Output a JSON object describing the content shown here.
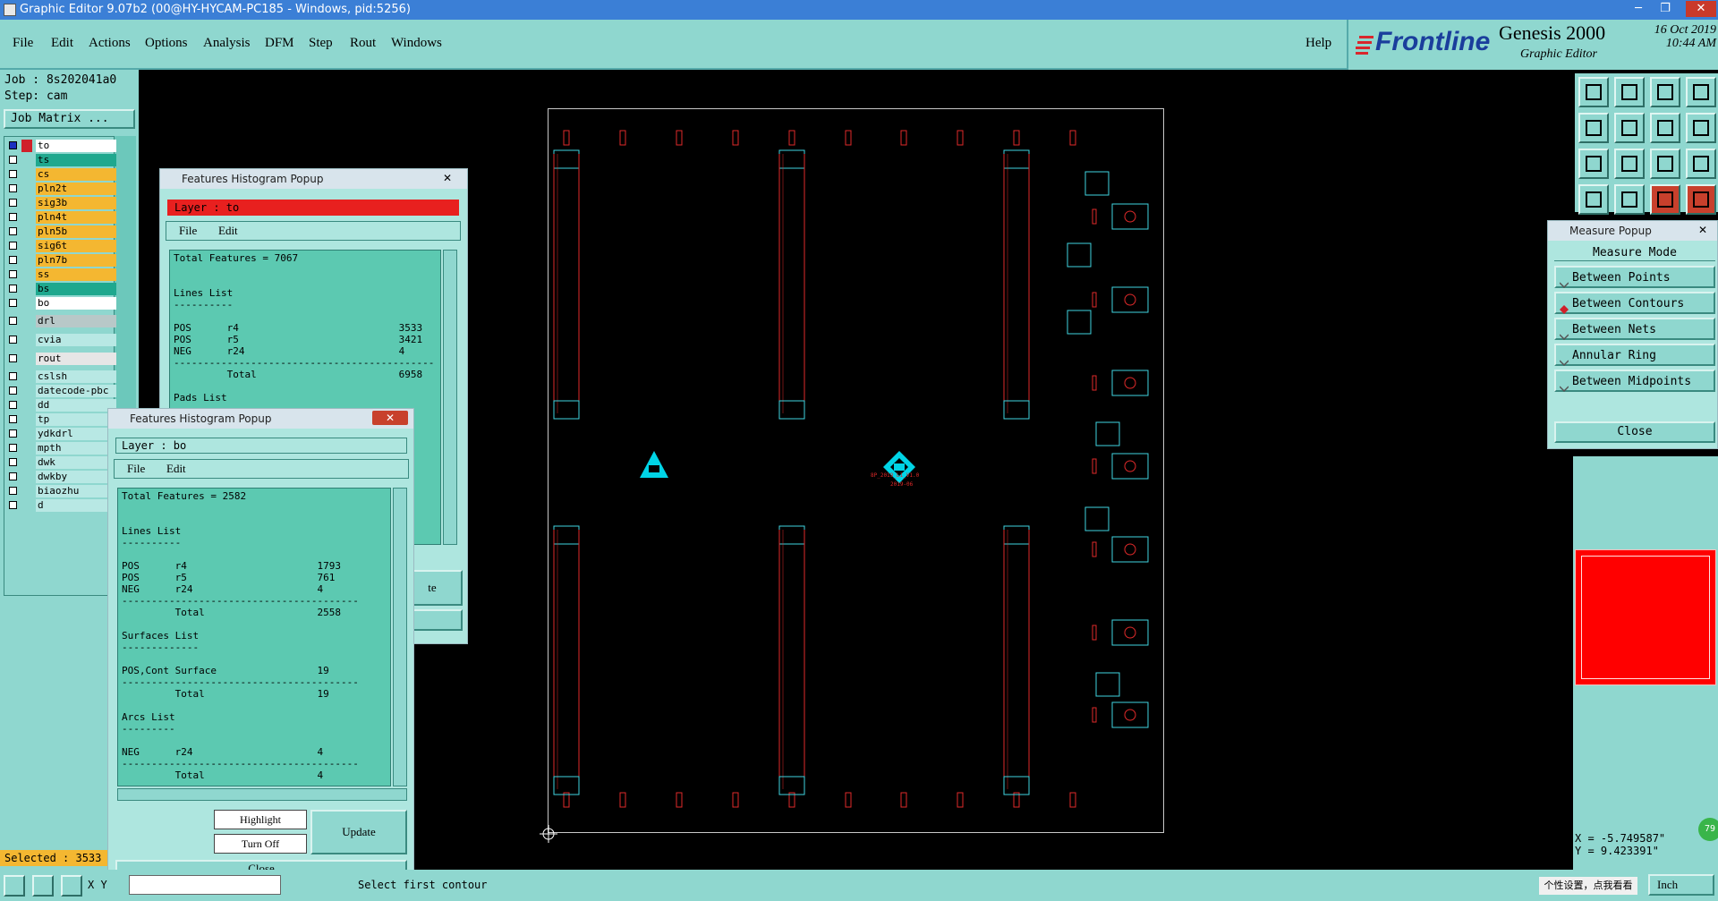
{
  "window": {
    "title": "Graphic Editor 9.07b2 (00@HY-HYCAM-PC185 - Windows, pid:5256)",
    "min": "─",
    "max": "❐",
    "close": "✕"
  },
  "menu": {
    "items": [
      "File",
      "Edit",
      "Actions",
      "Options",
      "Analysis",
      "DFM",
      "Step",
      "Rout",
      "Windows"
    ],
    "help": "Help"
  },
  "brand": {
    "logo": "Frontline",
    "product": "Genesis 2000",
    "subtitle": "Graphic Editor",
    "date": "16 Oct 2019",
    "time": "10:44 AM"
  },
  "job": {
    "job_label": "Job : 8s202041a0",
    "step_label": "Step: cam",
    "matrix_button": "Job Matrix ..."
  },
  "layers": [
    {
      "name": "to",
      "color": "#ffffff",
      "active": true
    },
    {
      "name": "ts",
      "color": "#1fa88e"
    },
    {
      "name": "cs",
      "color": "#f4b731"
    },
    {
      "name": "pln2t",
      "color": "#f4b731"
    },
    {
      "name": "sig3b",
      "color": "#f4b731"
    },
    {
      "name": "pln4t",
      "color": "#f4b731"
    },
    {
      "name": "pln5b",
      "color": "#f4b731"
    },
    {
      "name": "sig6t",
      "color": "#f4b731"
    },
    {
      "name": "pln7b",
      "color": "#f4b731"
    },
    {
      "name": "ss",
      "color": "#f4b731"
    },
    {
      "name": "bs",
      "color": "#1fa88e"
    },
    {
      "name": "bo",
      "color": "#ffffff"
    },
    {
      "name": "drl",
      "color": "#b8c8c8"
    },
    {
      "name": "cvia",
      "color": "#b8e8e4"
    },
    {
      "name": "rout",
      "color": "#e6e6e6"
    },
    {
      "name": "cslsh",
      "color": "#b8e8e4"
    },
    {
      "name": "datecode-pbc",
      "color": "#b8e8e4"
    },
    {
      "name": "dd",
      "color": "#b8e8e4"
    },
    {
      "name": "tp",
      "color": "#b8e8e4"
    },
    {
      "name": "ydkdrl",
      "color": "#b8e8e4"
    },
    {
      "name": "mpth",
      "color": "#b8e8e4"
    },
    {
      "name": "dwk",
      "color": "#b8e8e4"
    },
    {
      "name": "dwkby",
      "color": "#b8e8e4"
    },
    {
      "name": "biaozhu",
      "color": "#b8e8e4"
    },
    {
      "name": "d",
      "color": "#b8e8e4"
    }
  ],
  "selected": "Selected : 3533",
  "popup1": {
    "title": "Features Histogram Popup",
    "layer": "Layer :  to",
    "menu": [
      "File",
      "Edit"
    ],
    "text": "Total Features = 7067\n\n\nLines List\n----------\n\nPOS      r4                           3533\nPOS      r5                           3421\nNEG      r24                          4\n--------------------------------------------\n         Total                        6958\n\nPads List",
    "partial_button": "te"
  },
  "popup2": {
    "title": "Features Histogram Popup",
    "layer": "Layer :  bo",
    "menu": [
      "File",
      "Edit"
    ],
    "text": "Total Features = 2582\n\n\nLines List\n----------\n\nPOS      r4                      1793\nPOS      r5                      761\nNEG      r24                     4\n----------------------------------------\n         Total                   2558\n\nSurfaces List\n-------------\n\nPOS,Cont Surface                 19\n----------------------------------------\n         Total                   19\n\nArcs List\n---------\n\nNEG      r24                     4\n----------------------------------------\n         Total                   4",
    "highlight": "Highlight",
    "turn_off": "Turn Off",
    "update": "Update",
    "close": "Close"
  },
  "measure": {
    "title": "Measure Popup",
    "mode_label": "Measure Mode",
    "options": [
      "Between Points",
      "Between Contours",
      "Between Nets",
      "Annular Ring",
      "Between Midpoints"
    ],
    "selected_index": 1,
    "close": "Close"
  },
  "coords": {
    "x": "X = -5.749587\"",
    "y": "Y =  9.423391\""
  },
  "status": {
    "xy": "X Y",
    "prompt": "Select first contour",
    "ime": "个性设置，点我看看",
    "units": "Inch"
  },
  "board": {
    "center_text": "8P_2019_L1_V1.0",
    "center_date": "2019-06",
    "badge": "79"
  }
}
